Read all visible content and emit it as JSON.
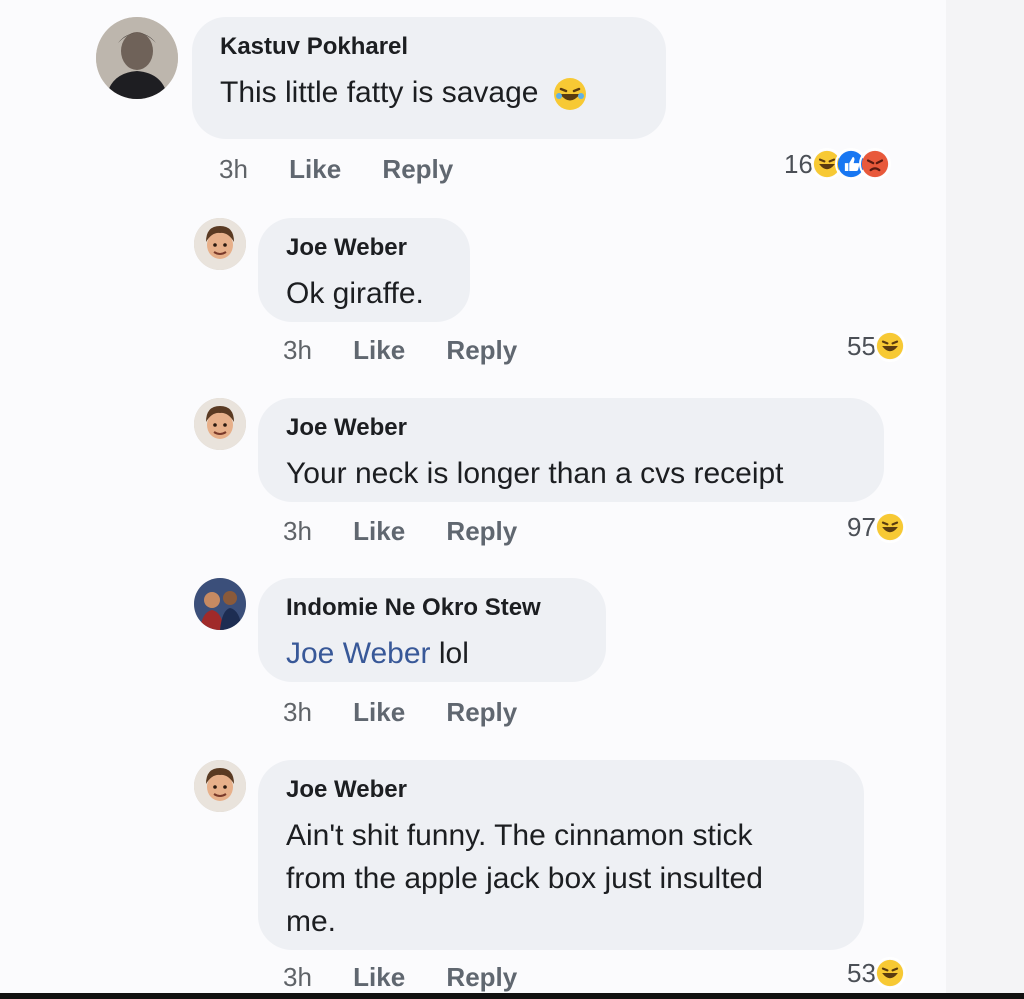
{
  "comments": [
    {
      "author": "Kastuv Pokharel",
      "text": "This little fatty is savage",
      "time": "3h",
      "like": "Like",
      "reply": "Reply",
      "reaction_count": "16",
      "reactions": [
        "haha-icon",
        "like-icon",
        "angry-icon"
      ]
    },
    {
      "author": "Joe Weber",
      "text": "Ok giraffe.",
      "time": "3h",
      "like": "Like",
      "reply": "Reply",
      "reaction_count": "55",
      "reactions": [
        "haha-icon"
      ]
    },
    {
      "author": "Joe Weber",
      "text": "Your neck is longer than a cvs receipt",
      "time": "3h",
      "like": "Like",
      "reply": "Reply",
      "reaction_count": "97",
      "reactions": [
        "haha-icon"
      ]
    },
    {
      "author": "Indomie Ne Okro Stew",
      "mention": "Joe Weber",
      "text": "lol",
      "time": "3h",
      "like": "Like",
      "reply": "Reply"
    },
    {
      "author": "Joe Weber",
      "text_lines": [
        "Ain't shit funny. The cinnamon stick",
        "from the apple jack box just insulted",
        "me."
      ],
      "time": "3h",
      "like": "Like",
      "reply": "Reply",
      "reaction_count": "53",
      "reactions": [
        "haha-icon"
      ]
    }
  ],
  "colors": {
    "bubble": "#eef0f4",
    "mention": "#385898",
    "haha": "#f7c934",
    "like": "#1877f2",
    "angry": "#e8593b"
  }
}
